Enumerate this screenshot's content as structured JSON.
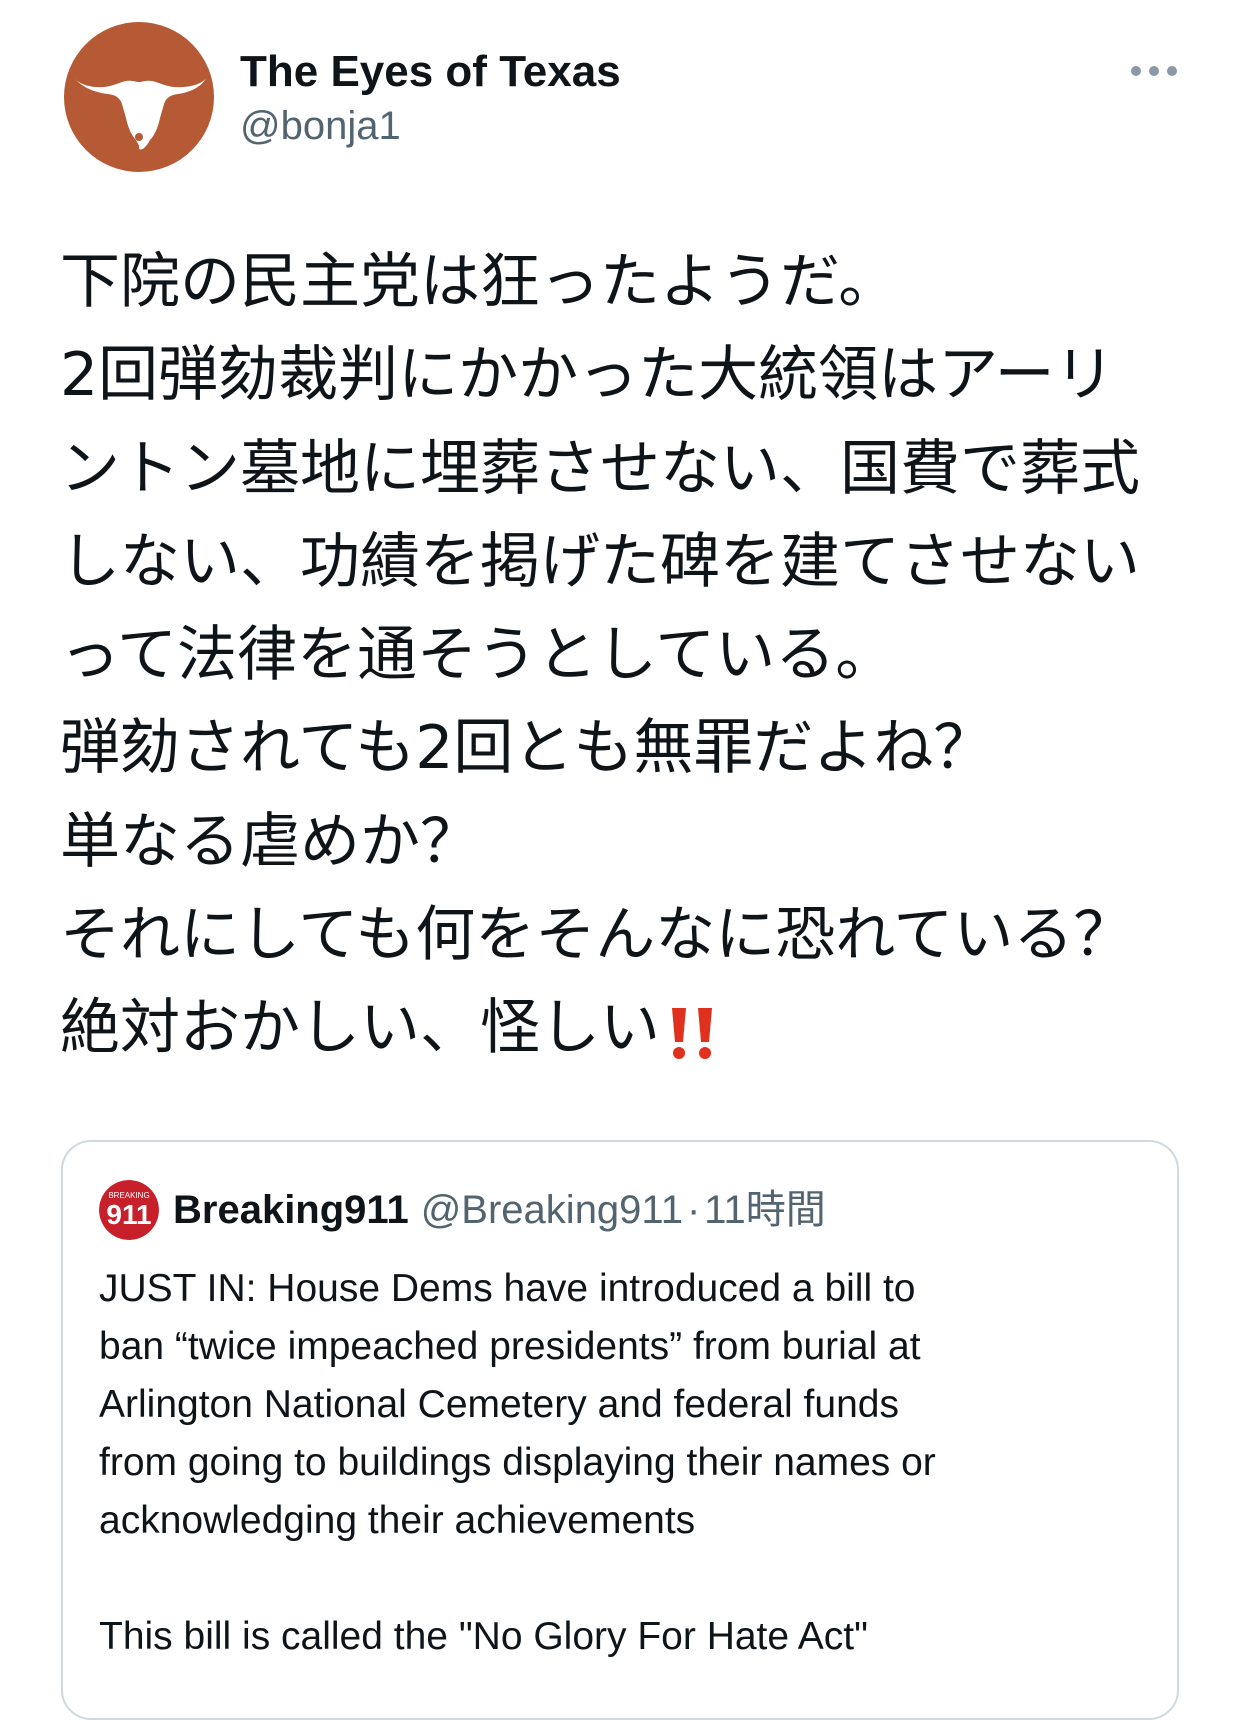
{
  "author": {
    "name": "The Eyes of Texas",
    "handle": "@bonja1",
    "avatar_icon": "longhorn-logo-icon",
    "avatar_color": "#b55a35"
  },
  "more_icon": "more-dots-icon",
  "tweet": {
    "lines": [
      "下院の民主党は狂ったようだ。",
      "2回弾劾裁判にかかった大統領はアーリ",
      "ントン墓地に埋葬させない、国費で葬式",
      "しない、功績を掲げた碑を建てさせない",
      "って法律を通そうとしている。",
      "弾劾されても2回とも無罪だよね？",
      "単なる虐めか？",
      "それにしても何をそんなに恐れている？",
      "絶対おかしい、怪しい"
    ],
    "emoji": "double-exclamation-icon",
    "emoji_color": "#e0301e"
  },
  "quote": {
    "name": "Breaking911",
    "handle": "@Breaking911",
    "separator": "·",
    "time": "11時間",
    "avatar_icon": "breaking911-logo-icon",
    "avatar_color": "#c8202a",
    "logo_small_text": "BREAKING",
    "logo_big_text": "911",
    "lines": [
      "JUST IN: House Dems have introduced a bill to",
      "ban “twice impeached presidents” from burial at",
      "Arlington National Cemetery and federal funds",
      "from going to buildings displaying their names or",
      "acknowledging their achievements"
    ],
    "footer_line": "This bill is called the \"No Glory For Hate Act\""
  },
  "colors": {
    "text_primary": "#0f1419",
    "text_secondary": "#536471",
    "border": "#cfd9de"
  }
}
